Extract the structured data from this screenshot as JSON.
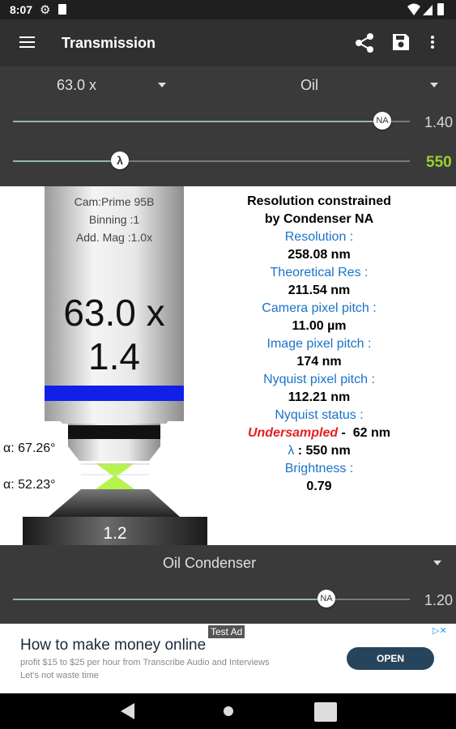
{
  "status": {
    "time": "8:07"
  },
  "appbar": {
    "title": "Transmission",
    "share_icon": "share-icon",
    "save_icon": "save-icon",
    "menu_icon": "hamburger-menu-icon",
    "more_icon": "more-vert-icon"
  },
  "controls": {
    "magnification": "63.0 x",
    "immersion": "Oil",
    "na_thumb": "NA",
    "na_value": "1.40",
    "na_fraction": 0.93,
    "lambda_thumb": "λ",
    "wavelength_value": "550",
    "wavelength_fraction": 0.27,
    "wavelength_color": "#9bd12f"
  },
  "objective": {
    "camera": "Cam:Prime 95B",
    "binning": "Binning :1",
    "add_mag": "Add. Mag :1.0x",
    "mag_label": "63.0 x",
    "na_label": "1.4",
    "band_color": "#1020e8"
  },
  "angles": {
    "objective_angle": "α: 67.26°",
    "condenser_angle": "α: 52.23°"
  },
  "condenser_lens": {
    "label": "1.2"
  },
  "info": {
    "heading_line1": "Resolution constrained",
    "heading_line2": "by Condenser NA",
    "resolution_label": "Resolution :",
    "resolution_value": "258.08 nm",
    "theoretical_label": "Theoretical Res :",
    "theoretical_value": "211.54 nm",
    "camera_pitch_label": "Camera pixel pitch :",
    "camera_pitch_value": "11.00 µm",
    "image_pitch_label": "Image pixel pitch :",
    "image_pitch_value": "174 nm",
    "nyquist_pitch_label": "Nyquist pixel pitch :",
    "nyquist_pitch_value": "112.21 nm",
    "nyquist_status_label": "Nyquist status :",
    "nyquist_status": "Undersampled",
    "nyquist_delta": " -  62 nm",
    "lambda_label": "λ",
    "lambda_value": " : 550 nm",
    "brightness_label": "Brightness :",
    "brightness_value": "0.79"
  },
  "condenser": {
    "type": "Oil Condenser",
    "na_thumb": "NA",
    "na_value": "1.20",
    "na_fraction": 0.79
  },
  "ad": {
    "badge": "Test Ad",
    "headline": "How to make money online",
    "line1": "profit $15 to $25 per hour from Transcribe Audio and Interviews",
    "line2": "Let's not waste time",
    "cta": "OPEN"
  }
}
